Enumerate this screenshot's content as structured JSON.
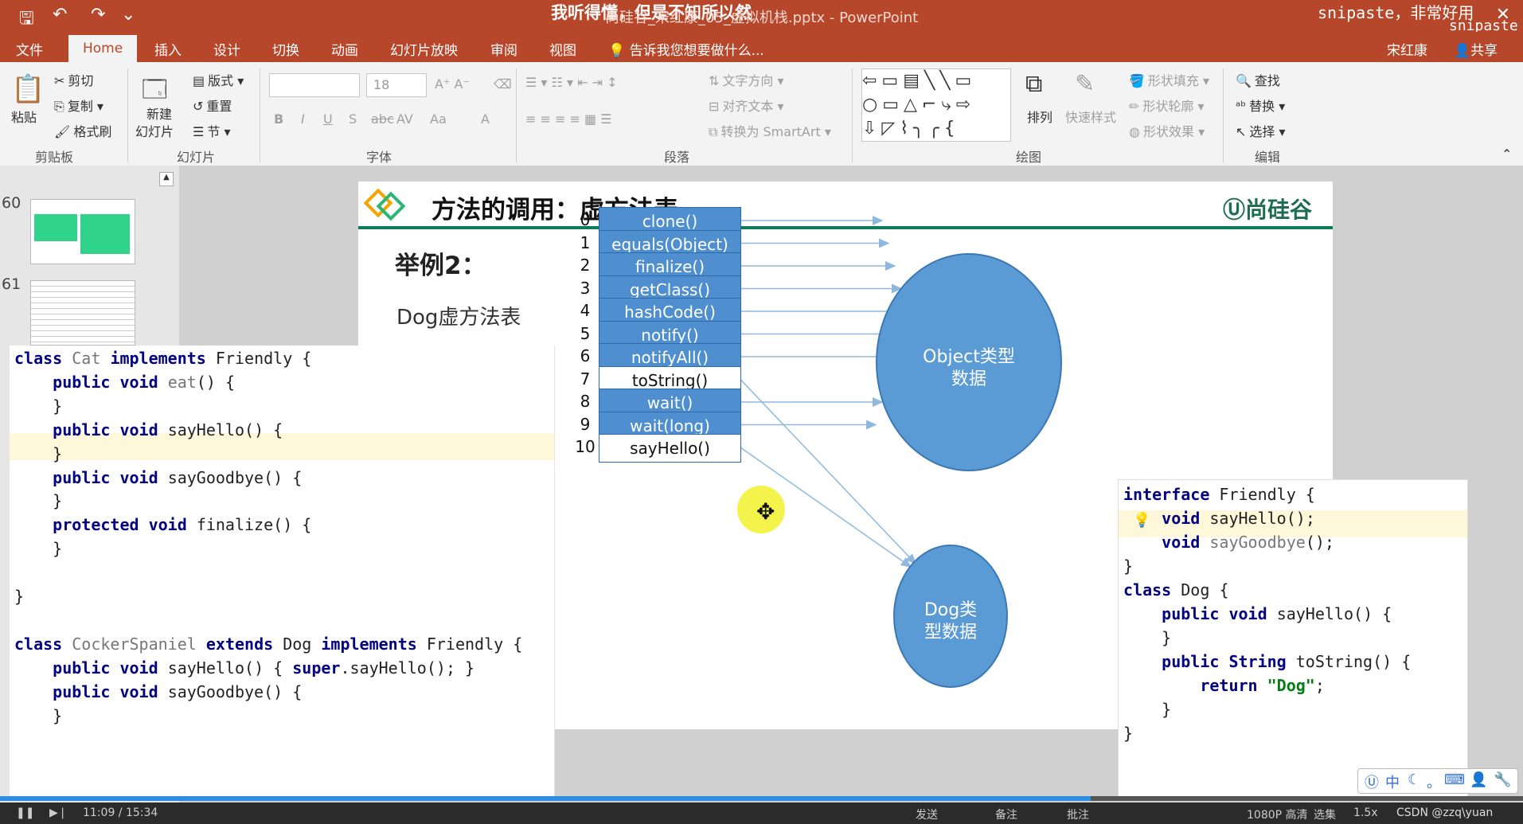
{
  "window": {
    "title": "尚硅谷_宋红康_05_虚拟机栈.pptx - PowerPoint",
    "overlay_text": "我听得懂，但是不知所以然",
    "snipaste_text": "snipaste，非常好用",
    "snipaste_text2": "snipaste",
    "close_glyph": "✕"
  },
  "tabs": [
    "文件",
    "Home",
    "插入",
    "设计",
    "切换",
    "动画",
    "幻灯片放映",
    "审阅",
    "视图",
    "告诉我您想要做什么..."
  ],
  "user": {
    "name": "宋红康",
    "share": "共享"
  },
  "ribbon": {
    "clipboard": {
      "paste": "粘贴",
      "cut": "剪切",
      "copy": "复制",
      "format_painter": "格式刷",
      "group": "剪贴板"
    },
    "slides": {
      "new_slide": "新建",
      "new_slide2": "幻灯片",
      "layout": "版式",
      "reset": "重置",
      "section": "节",
      "group": "幻灯片"
    },
    "font": {
      "size": "18",
      "group": "字体",
      "bold": "B",
      "italic": "I",
      "underline": "U",
      "shadow": "S",
      "strike": "abc",
      "spacing": "AV",
      "case": "Aa",
      "color": "A"
    },
    "paragraph": {
      "text_direction": "文字方向",
      "align_text": "对齐文本",
      "smartart": "转换为 SmartArt",
      "group": "段落"
    },
    "drawing": {
      "arrange": "排列",
      "quick_styles": "快速样式",
      "fill": "形状填充",
      "outline": "形状轮廓",
      "effect": "形状效果",
      "group": "绘图"
    },
    "editing": {
      "find": "查找",
      "replace": "替换",
      "select": "选择",
      "group": "编辑"
    }
  },
  "thumbnails": [
    {
      "num": "60"
    },
    {
      "num": "61"
    }
  ],
  "slide": {
    "title": "方法的调用：虚方法表",
    "logo": "尚硅谷",
    "example_label": "举例2：",
    "table_label": "Dog虚方法表",
    "vtable": [
      {
        "idx": "0",
        "method": "clone()",
        "white": false
      },
      {
        "idx": "1",
        "method": "equals(Object)",
        "white": false
      },
      {
        "idx": "2",
        "method": "finalize()",
        "white": false
      },
      {
        "idx": "3",
        "method": "getClass()",
        "white": false
      },
      {
        "idx": "4",
        "method": "hashCode()",
        "white": false
      },
      {
        "idx": "5",
        "method": "notify()",
        "white": false
      },
      {
        "idx": "6",
        "method": "notifyAll()",
        "white": false
      },
      {
        "idx": "7",
        "method": "toString()",
        "white": true
      },
      {
        "idx": "8",
        "method": "wait()",
        "white": false
      },
      {
        "idx": "9",
        "method": "wait(long)",
        "white": false
      },
      {
        "idx": "10",
        "method": "sayHello()",
        "white": true
      }
    ],
    "object_ellipse": [
      "Object类型",
      "数据"
    ],
    "dog_ellipse": [
      "Dog类",
      "型数据"
    ]
  },
  "code_left": {
    "lines": [
      "class Cat implements Friendly {",
      "    public void eat() {",
      "    }",
      "    public void sayHello() {",
      "    }",
      "    public void sayGoodbye() {",
      "    }",
      "    protected void finalize() {",
      "    }",
      "",
      "}",
      "",
      "class CockerSpaniel extends Dog implements Friendly {",
      "    public void sayHello() { super.sayHello(); }",
      "    public void sayGoodbye() {",
      "    }"
    ]
  },
  "code_right": {
    "lines": [
      "interface Friendly {",
      "    void sayHello();",
      "    void sayGoodbye();",
      "}",
      "class Dog {",
      "    public void sayHello() {",
      "    }",
      "    public String toString() {",
      "        return \"Dog\";",
      "    }",
      "}"
    ]
  },
  "player": {
    "time": "11:09 / 15:34",
    "progress": 0.716,
    "send": "发送",
    "quality": "1080P 高清",
    "select": "选集",
    "speed": "1.5x",
    "notes": "备注",
    "comments": "批注",
    "watermark": "CSDN @zzq\\yuan"
  },
  "ime": {
    "chars": [
      "中",
      "。",
      "，"
    ]
  }
}
